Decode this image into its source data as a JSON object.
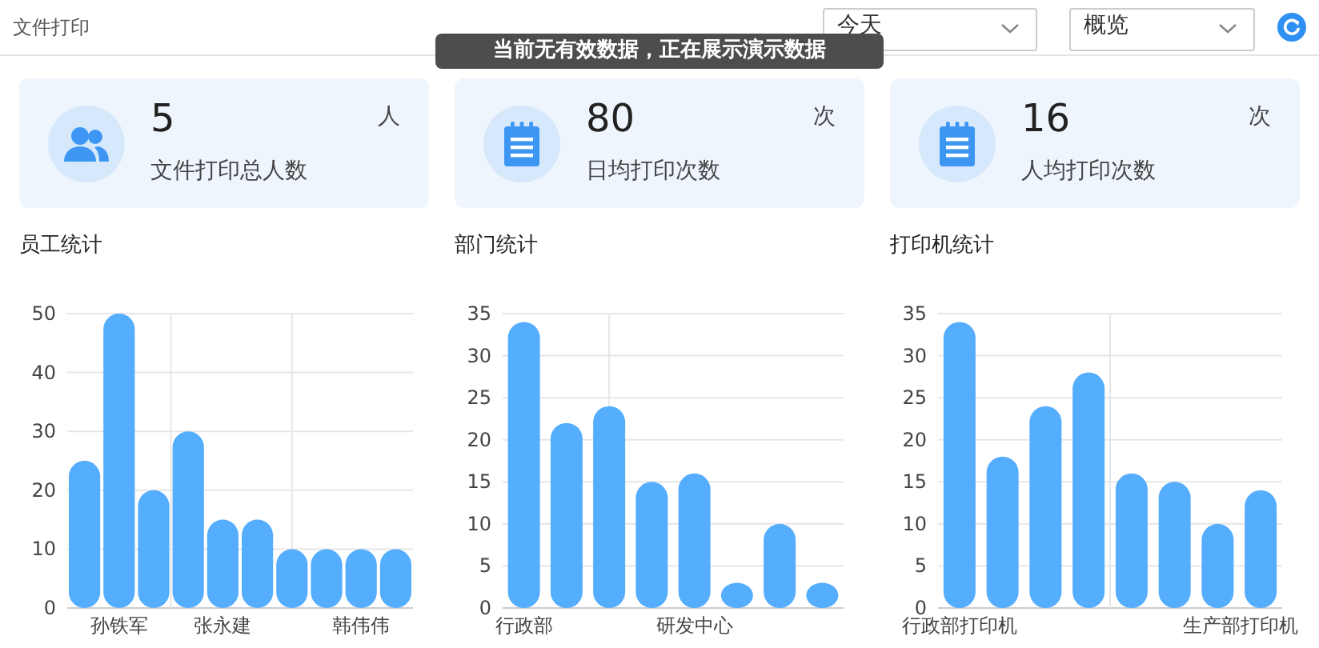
{
  "header": {
    "title": "文件打印"
  },
  "filters": [
    {
      "value": "今天"
    },
    {
      "value": "概览"
    }
  ],
  "notice": "当前无有效数据，正在展示演示数据",
  "stats": [
    {
      "value": "5",
      "unit": "人",
      "label": "文件打印总人数"
    },
    {
      "value": "80",
      "unit": "次",
      "label": "日均打印次数"
    },
    {
      "value": "16",
      "unit": "次",
      "label": "人均打印次数"
    }
  ],
  "charts": [
    {
      "title": "员工统计",
      "chart_data": {
        "type": "bar",
        "values": [
          25,
          50,
          20,
          30,
          15,
          15,
          10,
          10,
          10,
          10
        ],
        "ylim": [
          0,
          50
        ],
        "yticks": [
          0,
          10,
          20,
          30,
          40,
          50
        ],
        "grid": true,
        "categories": [
          null,
          "孙铁军",
          null,
          null,
          "张永建",
          null,
          null,
          null,
          "韩伟伟",
          null
        ]
      }
    },
    {
      "title": "部门统计",
      "chart_data": {
        "type": "bar",
        "values": [
          34,
          22,
          24,
          15,
          16,
          3,
          10,
          3
        ],
        "ylim": [
          0,
          35
        ],
        "yticks": [
          0,
          5,
          10,
          15,
          20,
          25,
          30,
          35
        ],
        "grid": true,
        "categories": [
          "行政部",
          null,
          null,
          null,
          "研发中心",
          null,
          null,
          null
        ]
      }
    },
    {
      "title": "打印机统计",
      "chart_data": {
        "type": "bar",
        "values": [
          34,
          18,
          24,
          28,
          16,
          15,
          10,
          14
        ],
        "ylim": [
          0,
          35
        ],
        "yticks": [
          0,
          5,
          10,
          15,
          20,
          25,
          30,
          35
        ],
        "grid": true,
        "categories": [
          "行政部打印机",
          null,
          null,
          null,
          null,
          null,
          null,
          "生产部打印机"
        ]
      }
    }
  ]
}
